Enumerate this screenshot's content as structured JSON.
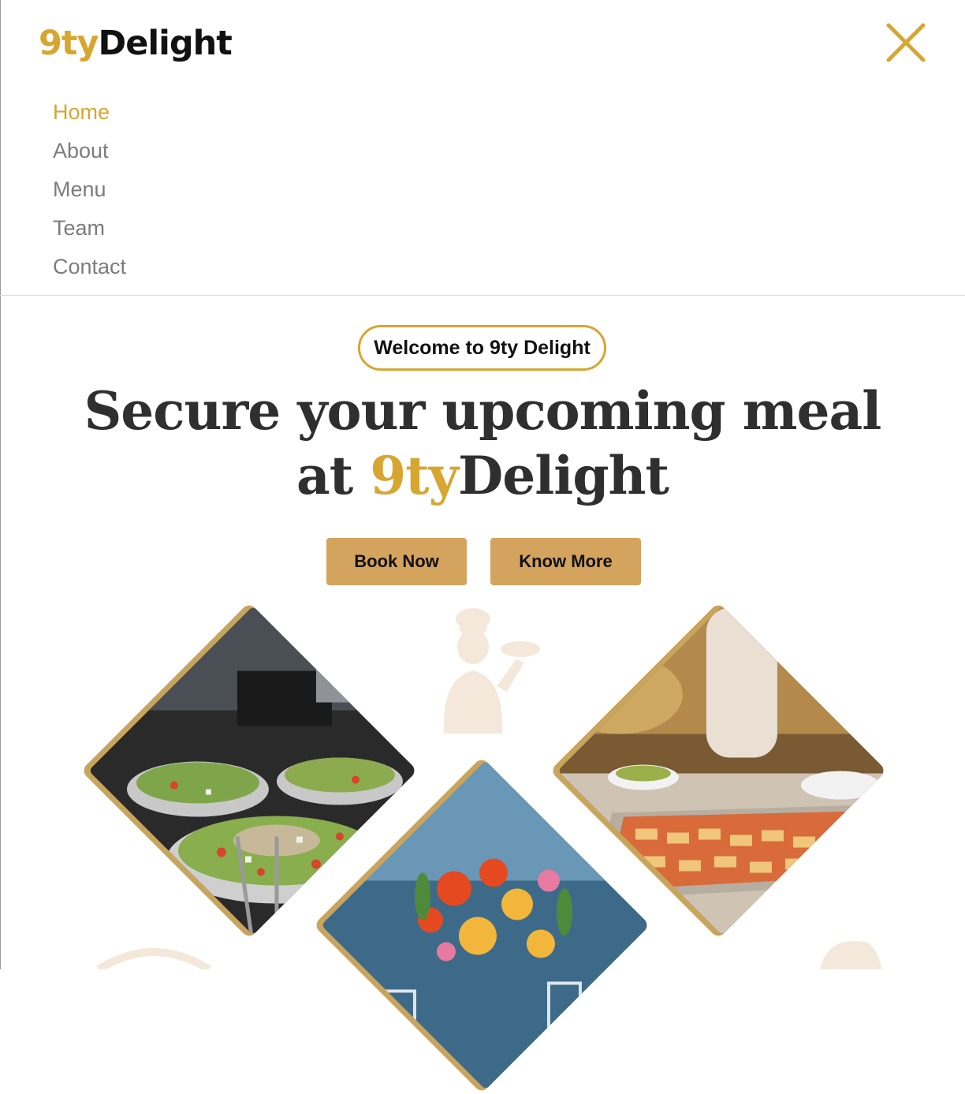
{
  "brand": {
    "logo_accent": "9ty",
    "logo_rest": "Delight",
    "accent_color": "#d7a631",
    "button_color": "#d4a35e"
  },
  "header": {
    "close_icon": "close-icon"
  },
  "nav": {
    "items": [
      "Home",
      "About",
      "Menu",
      "Team",
      "Contact"
    ],
    "active": "Home"
  },
  "hero": {
    "badge": "Welcome to 9ty Delight",
    "headline_line1": "Secure your upcoming meal",
    "headline_at": "at ",
    "headline_accent": "9ty",
    "headline_rest": "Delight",
    "buttons": {
      "book": "Book Now",
      "know": "Know More"
    }
  },
  "gallery": {
    "icons": [
      "salad-photo",
      "buffet-photo",
      "flowers-photo",
      "chef-illustration"
    ]
  }
}
